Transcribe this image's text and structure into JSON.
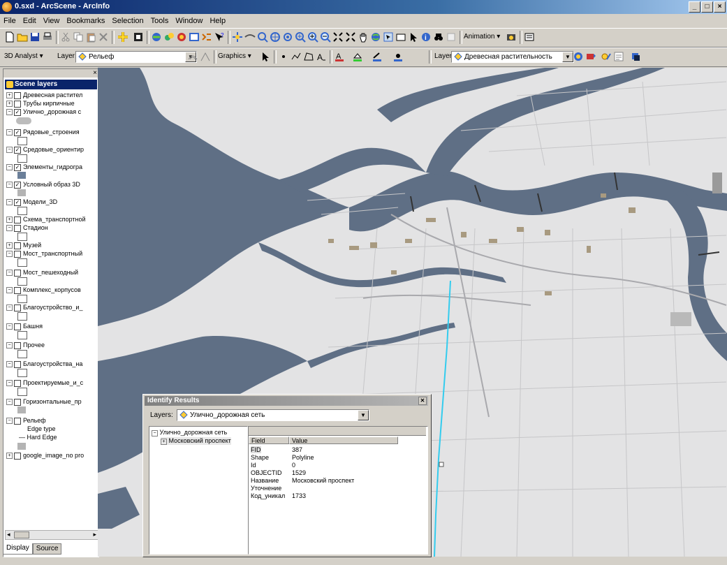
{
  "window": {
    "title": "0.sxd - ArcScene - ArcInfo",
    "min": "_",
    "max": "□",
    "close": "×"
  },
  "menu": [
    "File",
    "Edit",
    "View",
    "Bookmarks",
    "Selection",
    "Tools",
    "Window",
    "Help"
  ],
  "toolbar1": {
    "animation_label": "Animation ▾"
  },
  "toolbar2": {
    "analyst_label": "3D Analyst ▾",
    "layer_label": "Layer:",
    "layer_value": "Рельеф",
    "graphics_label": "Graphics ▾",
    "layer2_label": "Layer:",
    "layer2_value": "Древесная растительность"
  },
  "toc": {
    "header": "Scene layers",
    "layers": [
      {
        "name": "Древесная растител",
        "expand": "+",
        "checked": ""
      },
      {
        "name": "Трубы кирпичные",
        "expand": "+",
        "checked": ""
      },
      {
        "name": "Улично_дорожная с",
        "expand": "−",
        "checked": "✓"
      },
      {
        "name": "Рядовые_строения",
        "expand": "−",
        "checked": "✓"
      },
      {
        "name": "Средовые_ориентир",
        "expand": "−",
        "checked": "✓"
      },
      {
        "name": "Элементы_гидрогра",
        "expand": "−",
        "checked": "✓"
      },
      {
        "name": "Условный образ 3D",
        "expand": "−",
        "checked": "✓"
      },
      {
        "name": "Модели_3D",
        "expand": "−",
        "checked": "✓"
      },
      {
        "name": "Схема_транспортной",
        "expand": "+",
        "checked": ""
      },
      {
        "name": "Стадион",
        "expand": "−",
        "checked": ""
      },
      {
        "name": "Музей",
        "expand": "+",
        "checked": ""
      },
      {
        "name": "Мост_транспортный",
        "expand": "−",
        "checked": ""
      },
      {
        "name": "Мост_пешеходный",
        "expand": "−",
        "checked": ""
      },
      {
        "name": "Комплекс_корпусов",
        "expand": "−",
        "checked": ""
      },
      {
        "name": "Благоустройство_и_",
        "expand": "−",
        "checked": ""
      },
      {
        "name": "Башня",
        "expand": "−",
        "checked": ""
      },
      {
        "name": "Прочее",
        "expand": "−",
        "checked": ""
      },
      {
        "name": "Благоустройства_на",
        "expand": "−",
        "checked": ""
      },
      {
        "name": "Проектируемые_и_с",
        "expand": "−",
        "checked": ""
      },
      {
        "name": "Горизонтальные_пр",
        "expand": "−",
        "checked": ""
      },
      {
        "name": "Рельеф",
        "expand": "−",
        "checked": ""
      },
      {
        "name": "google_image_no pro",
        "expand": "+",
        "checked": ""
      }
    ],
    "edge_type": "Edge type",
    "hard_edge": "— Hard Edge",
    "scroll_left": "◂",
    "scroll_right": "▸",
    "tab_display": "Display",
    "tab_source": "Source"
  },
  "identify": {
    "title": "Identify Results",
    "layers_label": "Layers:",
    "layers_value": "Улично_дорожная сеть",
    "tree_root": "Улично_дорожная сеть",
    "tree_child": "Московский проспект",
    "col_field": "Field",
    "col_value": "Value",
    "rows": [
      {
        "field": "FID",
        "value": "387"
      },
      {
        "field": "Shape",
        "value": "Polyline"
      },
      {
        "field": "Id",
        "value": "0"
      },
      {
        "field": "OBJECTID",
        "value": "1529"
      },
      {
        "field": "Название",
        "value": "Московский проспект"
      },
      {
        "field": "Уточнение",
        "value": ""
      },
      {
        "field": "Код_уникал",
        "value": "1733"
      }
    ]
  },
  "colors": {
    "water": "#5f6f85",
    "land": "#e3e3e4",
    "highlight": "#33ccee",
    "title_active": "#0a246a"
  }
}
